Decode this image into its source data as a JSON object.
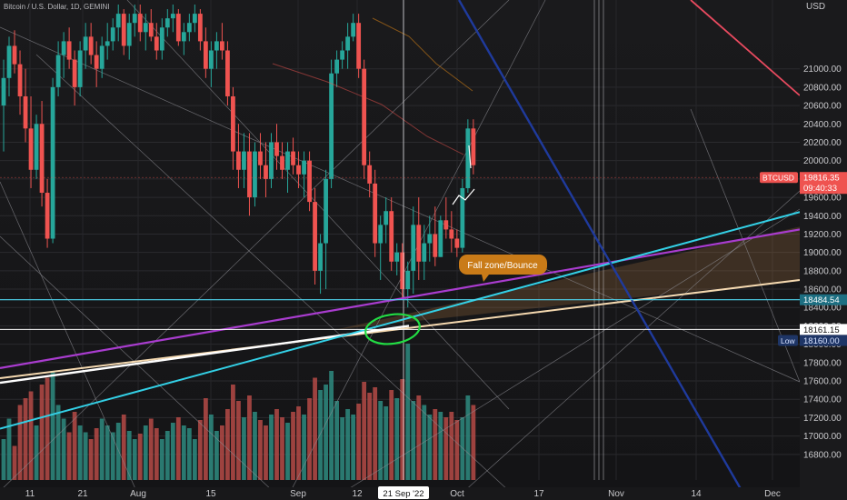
{
  "header": {
    "symbol_title": "Bitcoin / U.S. Dollar, 1D, GEMINI",
    "currency": "USD"
  },
  "colors": {
    "bull": "#26a69a",
    "bear": "#ef5350",
    "vol_bull": "#2e8b80",
    "vol_bear": "#b54a47",
    "cyan": "#33d0e6",
    "purple": "#a93ccf",
    "white": "#ffffff",
    "peach": "#f5d9b0",
    "navy": "#1f3a9c",
    "red": "#e84a5f",
    "orange": "#c97b18",
    "green": "#22dd44",
    "fill": "#c98a4a"
  },
  "chart_data": {
    "type": "candlestick",
    "title": "Bitcoin / U.S. Dollar, 1D, GEMINI",
    "ylim": [
      16620,
      21700
    ],
    "y_ticks": [
      16800,
      17000,
      17200,
      17400,
      17600,
      17800,
      18000,
      18200,
      18400,
      18600,
      18800,
      19000,
      19200,
      19400,
      19600,
      19800,
      20000,
      20200,
      20400,
      20600,
      20800,
      21000
    ],
    "x_ticks": [
      "11",
      "21",
      "Aug",
      "15",
      "Sep",
      "12",
      "21 Sep '22",
      "Oct",
      "17",
      "Nov",
      "14",
      "Dec"
    ],
    "x_tick_idx": [
      0,
      10,
      21,
      35,
      52,
      66,
      74,
      83,
      100,
      116,
      130,
      147
    ],
    "x_tick_col": [
      33,
      91,
      152,
      232,
      328,
      393,
      444,
      503,
      593,
      678,
      766,
      850
    ],
    "candles_ohlc": [
      [
        20600,
        21100,
        20100,
        20900
      ],
      [
        20900,
        21350,
        20700,
        21250
      ],
      [
        21250,
        21420,
        20950,
        21050
      ],
      [
        21050,
        21200,
        20500,
        20700
      ],
      [
        20700,
        21000,
        20200,
        20350
      ],
      [
        20350,
        20700,
        19700,
        19900
      ],
      [
        19900,
        20500,
        19800,
        20400
      ],
      [
        20400,
        20650,
        19500,
        19650
      ],
      [
        19650,
        19800,
        19050,
        19150
      ],
      [
        19150,
        20900,
        19100,
        20800
      ],
      [
        20800,
        21300,
        20700,
        21150
      ],
      [
        21150,
        21400,
        20900,
        21300
      ],
      [
        21300,
        21450,
        21000,
        21100
      ],
      [
        21100,
        21200,
        20600,
        20800
      ],
      [
        20800,
        21300,
        20700,
        21200
      ],
      [
        21200,
        21500,
        21000,
        21350
      ],
      [
        21350,
        21500,
        21050,
        21150
      ],
      [
        21150,
        21300,
        20800,
        21000
      ],
      [
        21000,
        21350,
        20900,
        21250
      ],
      [
        21250,
        21500,
        21100,
        21300
      ],
      [
        21300,
        21550,
        21200,
        21450
      ],
      [
        21450,
        21700,
        21300,
        21600
      ],
      [
        21600,
        21650,
        21150,
        21250
      ],
      [
        21250,
        21600,
        21100,
        21500
      ],
      [
        21500,
        21700,
        21350,
        21600
      ],
      [
        21600,
        21700,
        21300,
        21400
      ],
      [
        21400,
        21600,
        21200,
        21500
      ],
      [
        21500,
        21650,
        21300,
        21350
      ],
      [
        21350,
        21500,
        21100,
        21200
      ],
      [
        21200,
        21550,
        21100,
        21450
      ],
      [
        21450,
        21650,
        21350,
        21550
      ],
      [
        21550,
        21700,
        21400,
        21600
      ],
      [
        21600,
        21650,
        21250,
        21300
      ],
      [
        21300,
        21500,
        21150,
        21400
      ],
      [
        21400,
        21600,
        21300,
        21500
      ],
      [
        21500,
        21700,
        21400,
        21600
      ],
      [
        21600,
        21650,
        21200,
        21300
      ],
      [
        21300,
        21450,
        20900,
        21000
      ],
      [
        21000,
        21300,
        20800,
        21200
      ],
      [
        21200,
        21400,
        21000,
        21300
      ],
      [
        21300,
        21500,
        21100,
        21200
      ],
      [
        21200,
        21300,
        20600,
        20700
      ],
      [
        20700,
        20800,
        19900,
        20100
      ],
      [
        20100,
        20400,
        19700,
        19900
      ],
      [
        19900,
        20300,
        19700,
        20100
      ],
      [
        20100,
        20300,
        19400,
        19600
      ],
      [
        19600,
        20200,
        19500,
        20100
      ],
      [
        20100,
        20300,
        19800,
        19950
      ],
      [
        19950,
        20200,
        19600,
        19800
      ],
      [
        19800,
        20300,
        19700,
        20200
      ],
      [
        20200,
        20400,
        19900,
        20050
      ],
      [
        20050,
        20200,
        19800,
        19900
      ],
      [
        19900,
        20200,
        19650,
        20100
      ],
      [
        20100,
        20250,
        19850,
        19950
      ],
      [
        19950,
        20100,
        19700,
        19850
      ],
      [
        19850,
        20100,
        19600,
        20000
      ],
      [
        20000,
        20100,
        19450,
        19550
      ],
      [
        19550,
        19700,
        18650,
        18800
      ],
      [
        18800,
        19200,
        18550,
        19100
      ],
      [
        19100,
        19900,
        18600,
        19800
      ],
      [
        19800,
        21100,
        19700,
        20950
      ],
      [
        20950,
        21200,
        20800,
        21100
      ],
      [
        21100,
        21300,
        21000,
        21200
      ],
      [
        21200,
        21500,
        21000,
        21350
      ],
      [
        21350,
        21600,
        21300,
        21500
      ],
      [
        21500,
        21600,
        20900,
        21000
      ],
      [
        21000,
        21100,
        19800,
        19950
      ],
      [
        19950,
        20100,
        19600,
        19750
      ],
      [
        19750,
        19900,
        18950,
        19100
      ],
      [
        19100,
        19400,
        18700,
        19300
      ],
      [
        19300,
        19600,
        19100,
        19450
      ],
      [
        19450,
        19600,
        18800,
        18900
      ],
      [
        18900,
        19100,
        18750,
        19000
      ],
      [
        19000,
        19100,
        18500,
        18600
      ],
      [
        18600,
        18900,
        18400,
        18800
      ],
      [
        18800,
        19500,
        18550,
        19300
      ],
      [
        19300,
        19600,
        18700,
        18900
      ],
      [
        18900,
        19300,
        18700,
        19100
      ],
      [
        19100,
        19400,
        18900,
        19200
      ],
      [
        19200,
        19500,
        18850,
        18950
      ],
      [
        18950,
        19400,
        18950,
        19350
      ],
      [
        19350,
        19600,
        19150,
        19250
      ],
      [
        19250,
        19450,
        19000,
        19150
      ],
      [
        19150,
        19250,
        18950,
        19050
      ],
      [
        19050,
        19800,
        19000,
        19700
      ],
      [
        19700,
        20450,
        19650,
        20350
      ],
      [
        20350,
        20450,
        19850,
        19950
      ]
    ],
    "volume": [
      30,
      45,
      25,
      55,
      60,
      65,
      40,
      70,
      75,
      80,
      55,
      45,
      35,
      50,
      40,
      35,
      30,
      38,
      45,
      40,
      35,
      42,
      48,
      36,
      30,
      34,
      40,
      45,
      38,
      30,
      36,
      42,
      46,
      40,
      38,
      30,
      44,
      60,
      48,
      36,
      40,
      52,
      70,
      58,
      46,
      62,
      50,
      44,
      40,
      48,
      52,
      46,
      42,
      50,
      54,
      48,
      60,
      75,
      66,
      70,
      80,
      58,
      46,
      52,
      48,
      56,
      72,
      64,
      68,
      58,
      54,
      66,
      60,
      74,
      100,
      58,
      62,
      55,
      48,
      52,
      50,
      46,
      50,
      44,
      46,
      62,
      55
    ],
    "price_labels": [
      {
        "symbol": "BTCUSD",
        "value": "19816.35",
        "countdown": "09:40:33"
      },
      {
        "value": "18484.54"
      },
      {
        "value": "18161.15"
      },
      {
        "tag": "Low",
        "value": "18160.00"
      }
    ],
    "annotation": "Fall zone/Bounce"
  }
}
